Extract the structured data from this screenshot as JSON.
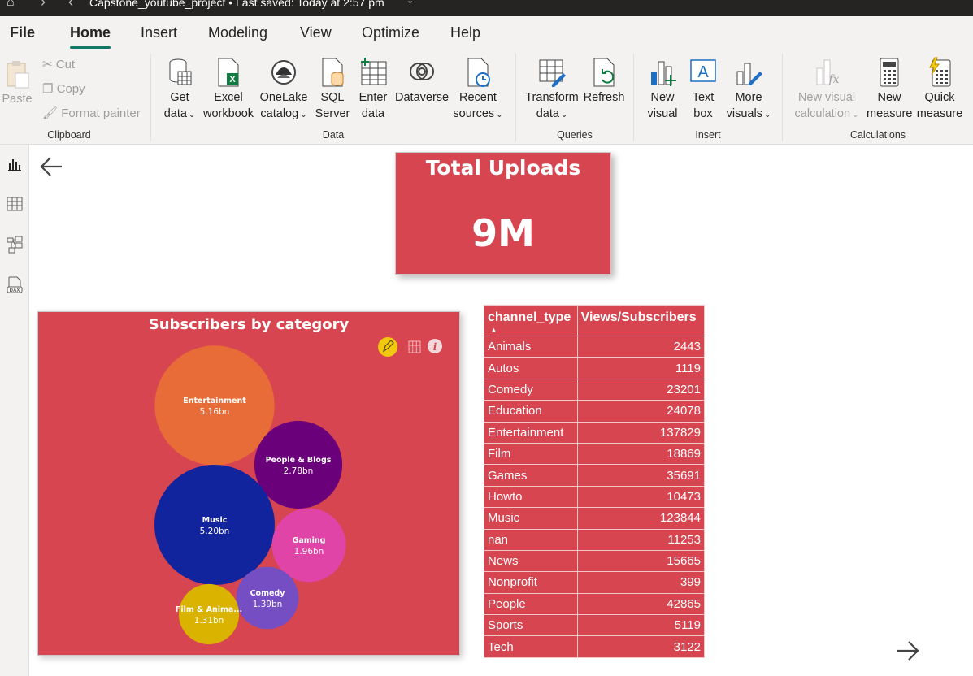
{
  "window": {
    "title": "Capstone_youtube_project • Last saved: Today at 2:57 pm"
  },
  "tabs": [
    "File",
    "Home",
    "Insert",
    "Modeling",
    "View",
    "Optimize",
    "Help"
  ],
  "ribbon": {
    "clipboard": {
      "paste": "Paste",
      "cut": "Cut",
      "copy": "Copy",
      "format_painter": "Format painter",
      "group": "Clipboard"
    },
    "data": {
      "get_data": [
        "Get",
        "data"
      ],
      "excel": [
        "Excel",
        "workbook"
      ],
      "onelake": [
        "OneLake",
        "catalog"
      ],
      "sql": [
        "SQL",
        "Server"
      ],
      "enter": [
        "Enter",
        "data"
      ],
      "dataverse": [
        "Dataverse"
      ],
      "recent": [
        "Recent",
        "sources"
      ],
      "group": "Data"
    },
    "queries": {
      "transform": [
        "Transform",
        "data"
      ],
      "refresh": [
        "Refresh"
      ],
      "group": "Queries"
    },
    "insert": {
      "new_visual": [
        "New",
        "visual"
      ],
      "text_box": [
        "Text",
        "box"
      ],
      "more_visuals": [
        "More",
        "visuals"
      ],
      "group": "Insert"
    },
    "calculations": {
      "new_visual_calc": [
        "New visual",
        "calculation"
      ],
      "new_measure": [
        "New",
        "measure"
      ],
      "quick_measure": [
        "Quick",
        "measure"
      ],
      "group": "Calculations"
    }
  },
  "card": {
    "title": "Total Uploads",
    "value": "9M"
  },
  "bubble_chart": {
    "title": "Subscribers by category",
    "bubbles": [
      {
        "name": "Entertainment",
        "label": "5.16bn",
        "value": 5.16,
        "color": "#e86c37"
      },
      {
        "name": "People & Blogs",
        "label": "2.78bn",
        "value": 2.78,
        "color": "#6b007b"
      },
      {
        "name": "Music",
        "label": "5.20bn",
        "value": 5.2,
        "color": "#12239e"
      },
      {
        "name": "Gaming",
        "label": "1.96bn",
        "value": 1.96,
        "color": "#e044a7"
      },
      {
        "name": "Comedy",
        "label": "1.39bn",
        "value": 1.39,
        "color": "#744ec2"
      },
      {
        "name": "Film & Anima...",
        "label": "1.31bn",
        "value": 1.31,
        "color": "#d9b300"
      }
    ]
  },
  "table": {
    "headers": [
      "channel_type",
      "Views/Subscribers"
    ],
    "rows": [
      [
        "Animals",
        "2443"
      ],
      [
        "Autos",
        "1119"
      ],
      [
        "Comedy",
        "23201"
      ],
      [
        "Education",
        "24078"
      ],
      [
        "Entertainment",
        "137829"
      ],
      [
        "Film",
        "18869"
      ],
      [
        "Games",
        "35691"
      ],
      [
        "Howto",
        "10473"
      ],
      [
        "Music",
        "123844"
      ],
      [
        "nan",
        "11253"
      ],
      [
        "News",
        "15665"
      ],
      [
        "Nonprofit",
        "399"
      ],
      [
        "People",
        "42865"
      ],
      [
        "Sports",
        "5119"
      ],
      [
        "Tech",
        "3122"
      ]
    ]
  },
  "chart_data": {
    "type": "scatter",
    "title": "Subscribers by category",
    "categories": [
      "Entertainment",
      "People & Blogs",
      "Music",
      "Gaming",
      "Comedy",
      "Film & Anima..."
    ],
    "values": [
      5.16,
      2.78,
      5.2,
      1.96,
      1.39,
      1.31
    ],
    "labels": [
      "5.16bn",
      "2.78bn",
      "5.20bn",
      "1.96bn",
      "1.39bn",
      "1.31bn"
    ]
  }
}
